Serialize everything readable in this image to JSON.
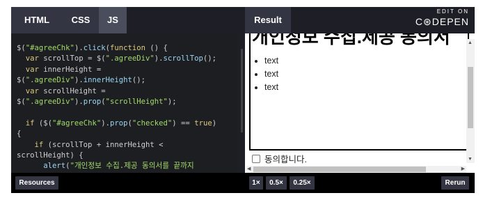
{
  "tabs": [
    {
      "label": "HTML",
      "active": false
    },
    {
      "label": "CSS",
      "active": false
    },
    {
      "label": "JS",
      "active": true
    }
  ],
  "result_tab": "Result",
  "brand": {
    "edit": "EDIT ON",
    "name": "C⊛DEPEN"
  },
  "code_lines": [
    "$(\"#agreeChk\").click(function () {",
    "  var scrollTop = $(\".agreeDiv\").scrollTop();",
    "  var innerHeight =",
    "$(\".agreeDiv\").innerHeight();",
    "  var scrollHeight =",
    "$(\".agreeDiv\").prop(\"scrollHeight\");",
    "",
    "  if ($(\"#agreeChk\").prop(\"checked\") == true)",
    "{",
    "    if (scrollTop + innerHeight <",
    "scrollHeight) {",
    "      alert(\"개인정보 수집.제공 동의서를 끝까지"
  ],
  "result": {
    "heading": "개인정보 수집.제공 동의서",
    "list_items": [
      "text",
      "text",
      "text"
    ],
    "checkbox_label": "동의합니다."
  },
  "bottom": {
    "resources": "Resources",
    "zoom": [
      "1×",
      "0.5×",
      "0.25×"
    ],
    "rerun": "Rerun"
  }
}
